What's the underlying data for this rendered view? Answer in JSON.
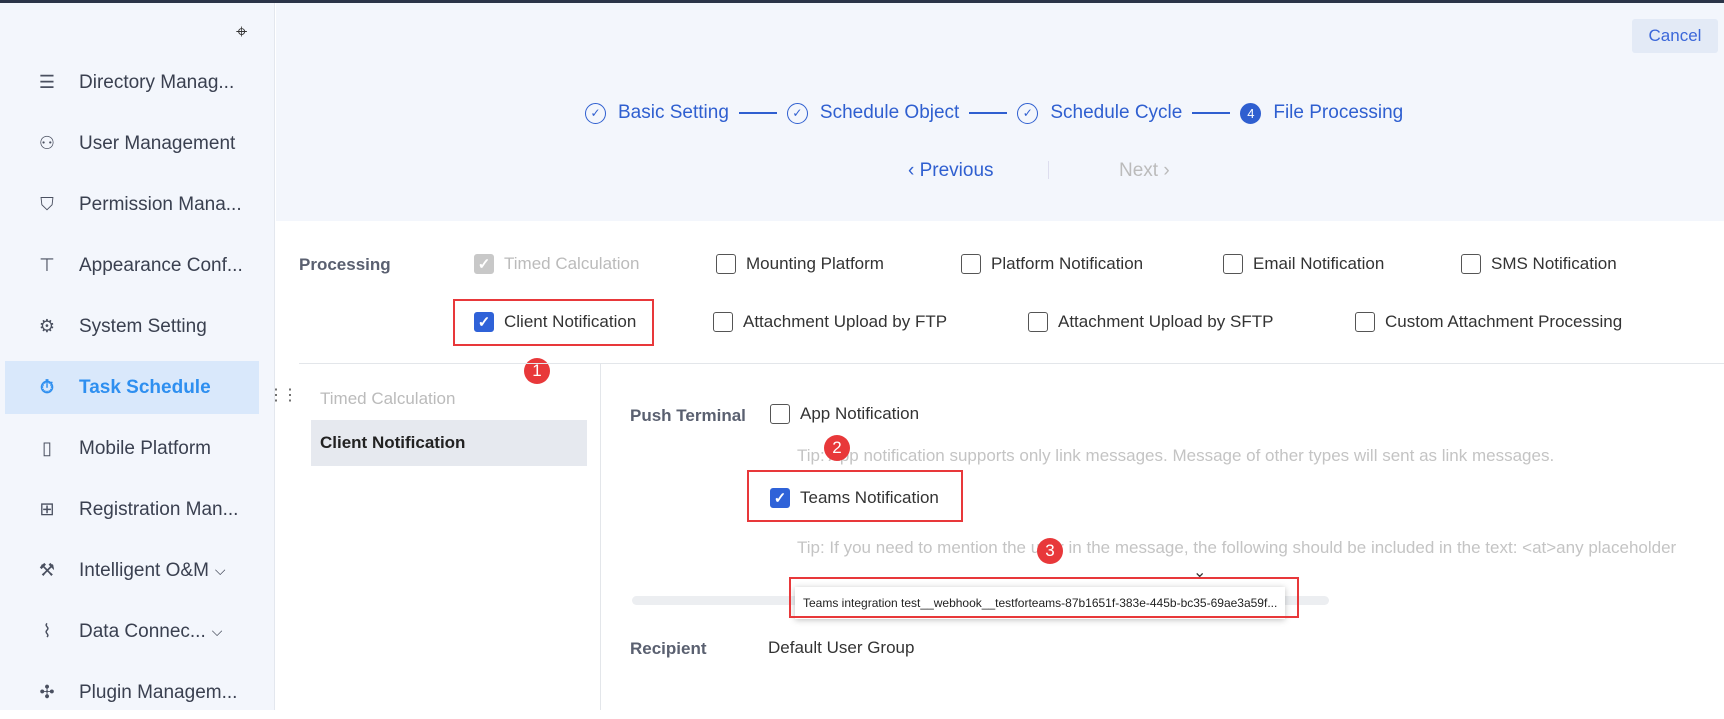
{
  "sidebar": {
    "items": [
      {
        "label": "Directory Manag...",
        "icon": "list-icon"
      },
      {
        "label": "User Management",
        "icon": "user-icon"
      },
      {
        "label": "Permission Mana...",
        "icon": "shield-icon"
      },
      {
        "label": "Appearance Conf...",
        "icon": "paint-roller-icon"
      },
      {
        "label": "System Setting",
        "icon": "gear-icon"
      },
      {
        "label": "Task Schedule",
        "icon": "stopwatch-icon",
        "active": true
      },
      {
        "label": "Mobile Platform",
        "icon": "mobile-icon"
      },
      {
        "label": "Registration Man...",
        "icon": "register-icon"
      },
      {
        "label": "Intelligent O&M",
        "icon": "wrench-icon",
        "expandable": true
      },
      {
        "label": "Data Connec...",
        "icon": "paperclip-icon",
        "expandable": true
      },
      {
        "label": "Plugin Managem...",
        "icon": "puzzle-icon"
      }
    ]
  },
  "header": {
    "cancel": "Cancel",
    "steps": [
      {
        "label": "Basic Setting",
        "state": "done"
      },
      {
        "label": "Schedule Object",
        "state": "done"
      },
      {
        "label": "Schedule Cycle",
        "state": "done"
      },
      {
        "label": "File Processing",
        "state": "current",
        "number": "4"
      }
    ],
    "previous": "Previous",
    "next": "Next"
  },
  "processing": {
    "label": "Processing",
    "options": [
      {
        "label": "Timed Calculation",
        "checked": true,
        "disabled": true
      },
      {
        "label": "Mounting Platform",
        "checked": false
      },
      {
        "label": "Platform Notification",
        "checked": false
      },
      {
        "label": "Email Notification",
        "checked": false
      },
      {
        "label": "SMS Notification",
        "checked": false
      },
      {
        "label": "Client Notification",
        "checked": true
      },
      {
        "label": "Attachment Upload by FTP",
        "checked": false
      },
      {
        "label": "Attachment Upload by SFTP",
        "checked": false
      },
      {
        "label": "Custom Attachment Processing",
        "checked": false
      }
    ]
  },
  "subnav": [
    "Timed Calculation",
    "Client Notification"
  ],
  "client": {
    "push_terminal_label": "Push Terminal",
    "app_notification": "App Notification",
    "app_tip": "Tip: App notification supports only link messages. Message of other types will sent as link messages.",
    "teams_notification": "Teams Notification",
    "teams_tip": "Tip: If you need to mention the user in the message, the following should be included in the text: <at>any placeholder",
    "teams_webhook": "Teams integration test__webhook__testforteams-87b1651f-383e-445b-bc35-69ae3a59f...",
    "recipient_label": "Recipient",
    "recipient_value": "Default User Group"
  },
  "annotations": [
    "1",
    "2",
    "3"
  ]
}
